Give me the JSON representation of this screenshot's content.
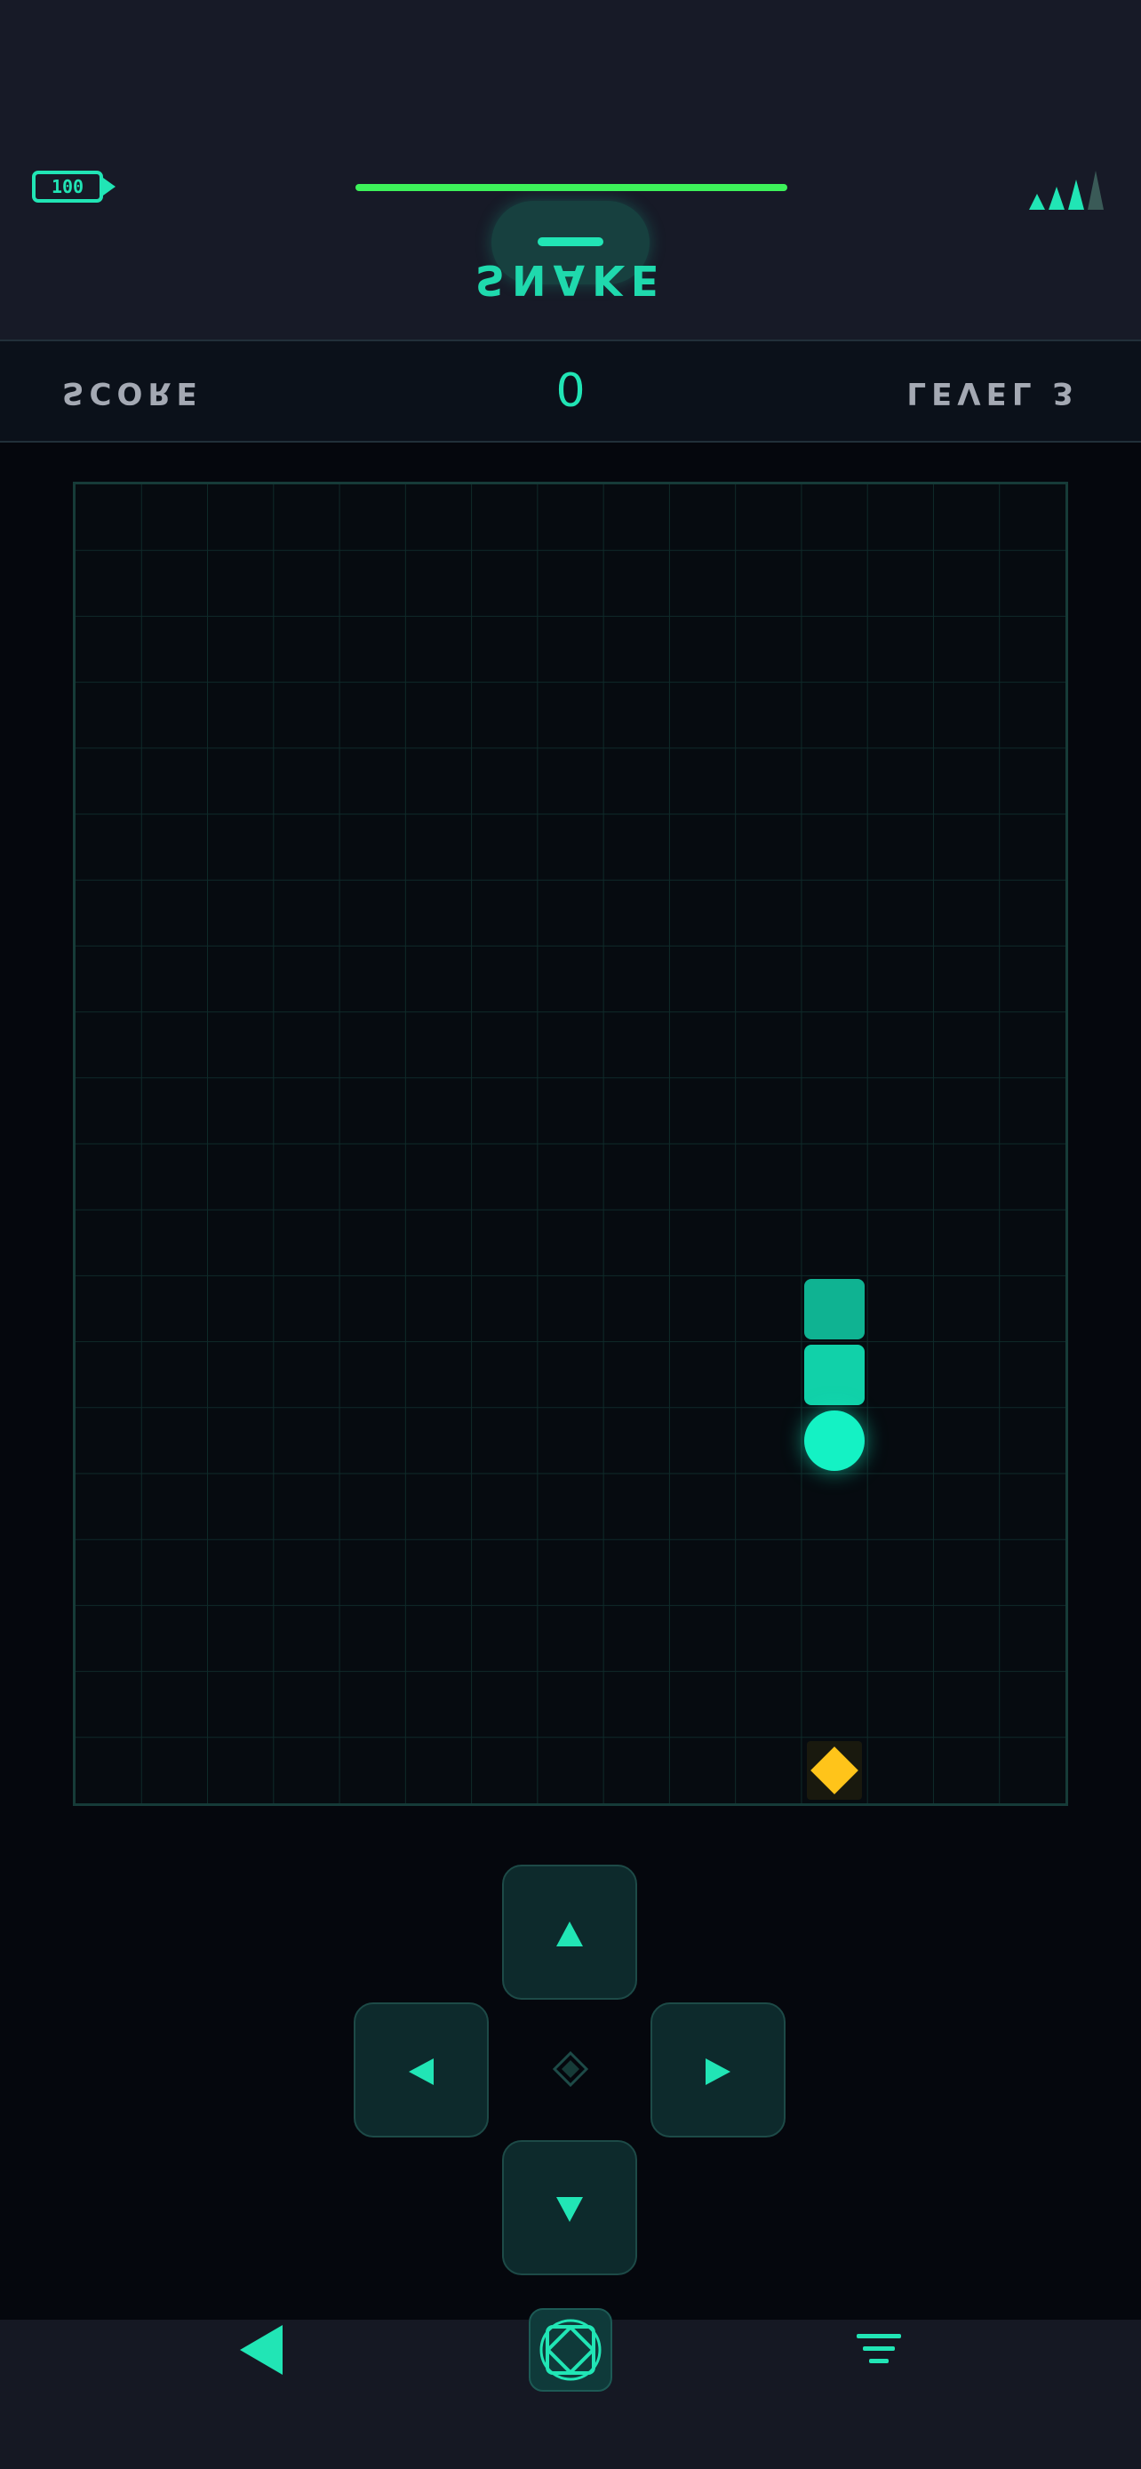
{
  "status": {
    "battery": "100",
    "progress": 1.0,
    "colors": {
      "accent": "#21e5b5",
      "progress": "#3df25a",
      "signal_active": "#21e5b5",
      "signal_dim": "#3a5a57"
    }
  },
  "header": {
    "title": "SNAKE"
  },
  "scoreboard": {
    "score_label": "SCORE",
    "score_value": "0",
    "level_label": "LEVEL 3"
  },
  "board": {
    "columns": 15,
    "rows": 20,
    "snake": [
      {
        "col": 11,
        "row": 12,
        "part": "body"
      },
      {
        "col": 11,
        "row": 13,
        "part": "body"
      },
      {
        "col": 11,
        "row": 14,
        "part": "head"
      }
    ],
    "food": {
      "col": 11,
      "row": 19
    },
    "colors": {
      "grid": "#0f2b2a",
      "body_tail": "#0fb392",
      "body": "#11d1a9",
      "head": "#14f2c4",
      "food": "#ffc41a"
    }
  },
  "controls": {
    "up_icon": "arrow-up-icon",
    "down_icon": "arrow-down-icon",
    "left_icon": "arrow-left-icon",
    "right_icon": "arrow-right-icon",
    "center_icon": "diamond-icon"
  },
  "navbar": {
    "back_icon": "back-triangle-icon",
    "home_icon": "home-emblem-icon",
    "menu_icon": "menu-lines-icon"
  }
}
